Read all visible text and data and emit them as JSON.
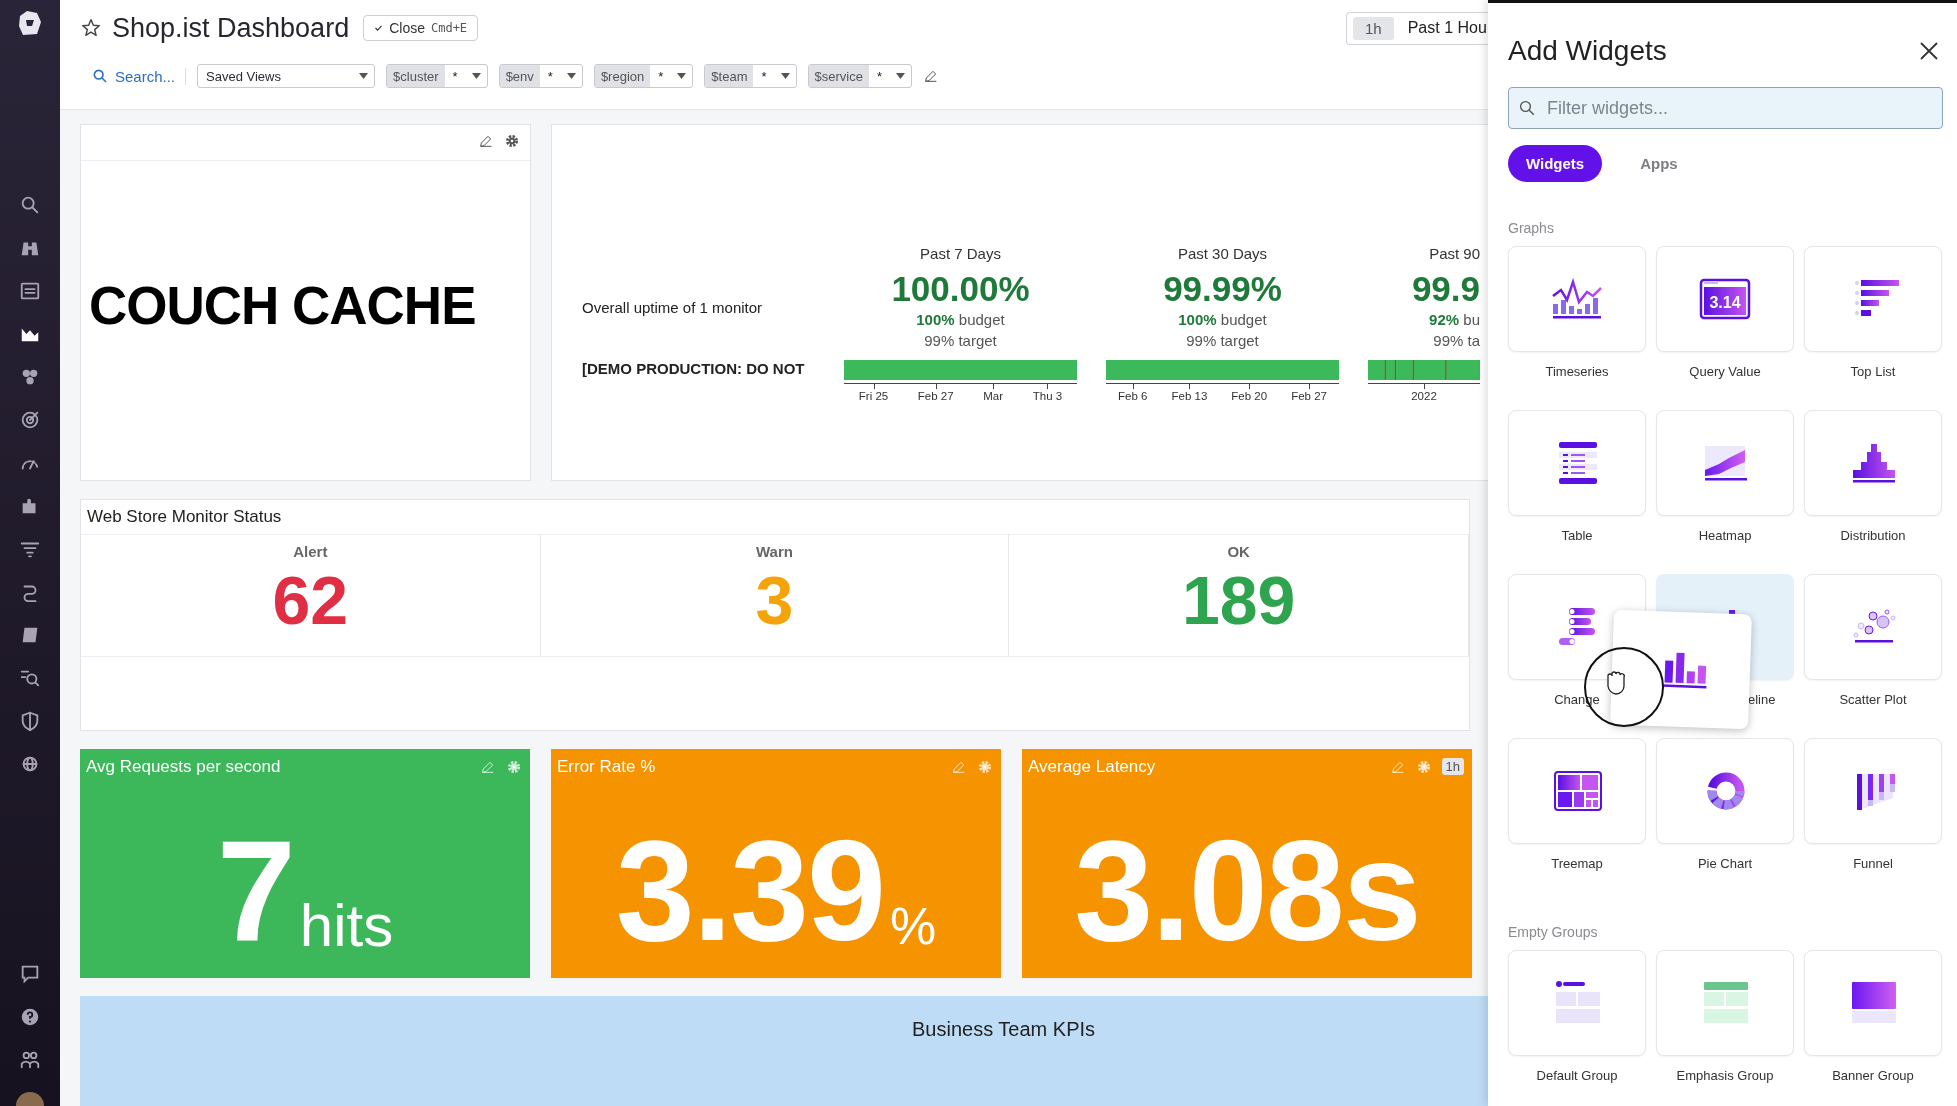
{
  "sidebar": {
    "items": [
      {
        "selected": false
      },
      {
        "selected": false
      },
      {
        "selected": false
      },
      {
        "selected": true
      },
      {
        "selected": false
      },
      {
        "selected": false
      },
      {
        "selected": false
      },
      {
        "selected": false
      },
      {
        "selected": false
      },
      {
        "selected": false
      },
      {
        "selected": false
      },
      {
        "selected": false
      },
      {
        "selected": false
      },
      {
        "selected": false
      }
    ],
    "bottom_items": [
      {
        "selected": false
      },
      {
        "selected": false
      },
      {
        "selected": false
      }
    ]
  },
  "header": {
    "title": "Shop.ist Dashboard",
    "starred": false,
    "close_button": {
      "label": "Close",
      "shortcut": "Cmd+E"
    },
    "time_range": {
      "chip": "1h",
      "label": "Past 1 Hou"
    }
  },
  "filter_bar": {
    "search": "Search...",
    "saved_views": "Saved Views",
    "template_variables": [
      {
        "name": "$cluster",
        "value": "*"
      },
      {
        "name": "$env",
        "value": "*"
      },
      {
        "name": "$region",
        "value": "*"
      },
      {
        "name": "$team",
        "value": "*"
      },
      {
        "name": "$service",
        "value": "*"
      }
    ]
  },
  "note_widget": {
    "text": "COUCH CACHE"
  },
  "slo_widget": {
    "rows": [
      "Overall uptime of 1 monitor",
      "[DEMO PRODUCTION: DO NOT"
    ],
    "columns": [
      {
        "period": "Past 7 Days",
        "value": "100.00%",
        "budget": "**100%** budget",
        "target": "99% target",
        "ticks": [
          "Fri 25",
          "Feb 27",
          "Mar",
          "Thu 3"
        ],
        "has_incidents": false,
        "clipped": false
      },
      {
        "period": "Past 30 Days",
        "value": "99.99%",
        "budget": "**100%** budget",
        "target": "99% target",
        "ticks": [
          "Feb 6",
          "Feb 13",
          "Feb 20",
          "Feb 27"
        ],
        "has_incidents": false,
        "clipped": false
      },
      {
        "period": "Past 90",
        "value": "99.9",
        "budget": "**92%** bu",
        "target": "99% ta",
        "ticks": [
          "2022"
        ],
        "has_incidents": true,
        "clipped": true
      }
    ]
  },
  "monitor_status": {
    "title": "Web Store Monitor Status",
    "cells": [
      {
        "label": "Alert",
        "count": "62",
        "color": "#e02f44"
      },
      {
        "label": "Warn",
        "count": "3",
        "color": "#f5a30a"
      },
      {
        "label": "OK",
        "count": "189",
        "color": "#2ea44f"
      }
    ]
  },
  "value_widgets": [
    {
      "title": "Avg Requests per second",
      "value": "7",
      "unit": "hits",
      "color": "#3cb85a"
    },
    {
      "title": "Error Rate %",
      "value": "3.39",
      "unit": "%",
      "color": "#f59300"
    },
    {
      "title": "Average Latency",
      "value": "3.08s",
      "color": "#f59300",
      "badge": "1h"
    }
  ],
  "group_banner": {
    "title": "Business Team KPIs"
  },
  "add_widgets_panel": {
    "title": "Add Widgets",
    "filter": {
      "placeholder": "Filter widgets..."
    },
    "tabs": [
      {
        "label": "Widgets",
        "selected": true
      },
      {
        "label": "Apps",
        "selected": false
      }
    ],
    "sections": [
      {
        "title": "Graphs",
        "tiles": [
          {
            "label": "Timeseries",
            "highlighted": false,
            "covered": false
          },
          {
            "label": "Query Value",
            "icon_text": "3.14",
            "highlighted": false,
            "covered": false
          },
          {
            "label": "Top List",
            "highlighted": false,
            "covered": false
          },
          {
            "label": "Table",
            "highlighted": false,
            "covered": false
          },
          {
            "label": "Heatmap",
            "highlighted": false,
            "covered": false
          },
          {
            "label": "Distribution",
            "highlighted": false,
            "covered": false
          },
          {
            "label": "Change",
            "highlighted": false,
            "covered": false
          },
          {
            "label": "eline",
            "highlighted": true,
            "covered": true
          },
          {
            "label": "Scatter Plot",
            "highlighted": false,
            "covered": false
          },
          {
            "label": "Treemap",
            "highlighted": false,
            "covered": false
          },
          {
            "label": "Pie Chart",
            "highlighted": false,
            "covered": false
          },
          {
            "label": "Funnel",
            "highlighted": false,
            "covered": false
          }
        ]
      },
      {
        "title": "Empty Groups",
        "tiles": [
          {
            "label": "Default Group",
            "highlighted": false,
            "covered": false
          },
          {
            "label": "Emphasis Group",
            "highlighted": false,
            "covered": false
          },
          {
            "label": "Banner Group",
            "highlighted": false,
            "covered": false
          }
        ]
      }
    ],
    "drag_preview": {
      "dragging": true
    }
  }
}
